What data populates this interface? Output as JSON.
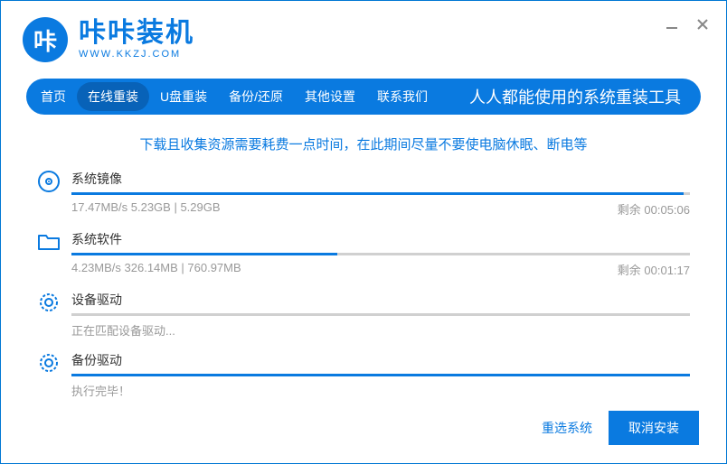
{
  "app": {
    "logo_char": "咔",
    "title": "咔咔装机",
    "url": "WWW.KKZJ.COM"
  },
  "nav": {
    "items": [
      "首页",
      "在线重装",
      "U盘重装",
      "备份/还原",
      "其他设置",
      "联系我们"
    ],
    "active_index": 1,
    "tagline": "人人都能使用的系统重装工具"
  },
  "notice": "下载且收集资源需要耗费一点时间，在此期间尽量不要使电脑休眠、断电等",
  "progress": [
    {
      "title": "系统镜像",
      "stats": "17.47MB/s 5.23GB | 5.29GB",
      "remaining": "剩余 00:05:06",
      "percent": 99
    },
    {
      "title": "系统软件",
      "stats": "4.23MB/s 326.14MB | 760.97MB",
      "remaining": "剩余 00:01:17",
      "percent": 43
    },
    {
      "title": "设备驱动",
      "stats": "正在匹配设备驱动...",
      "remaining": "",
      "percent": 0
    },
    {
      "title": "备份驱动",
      "stats": "执行完毕！",
      "remaining": "",
      "percent": 100
    }
  ],
  "footer": {
    "reselect": "重选系统",
    "cancel": "取消安装"
  }
}
